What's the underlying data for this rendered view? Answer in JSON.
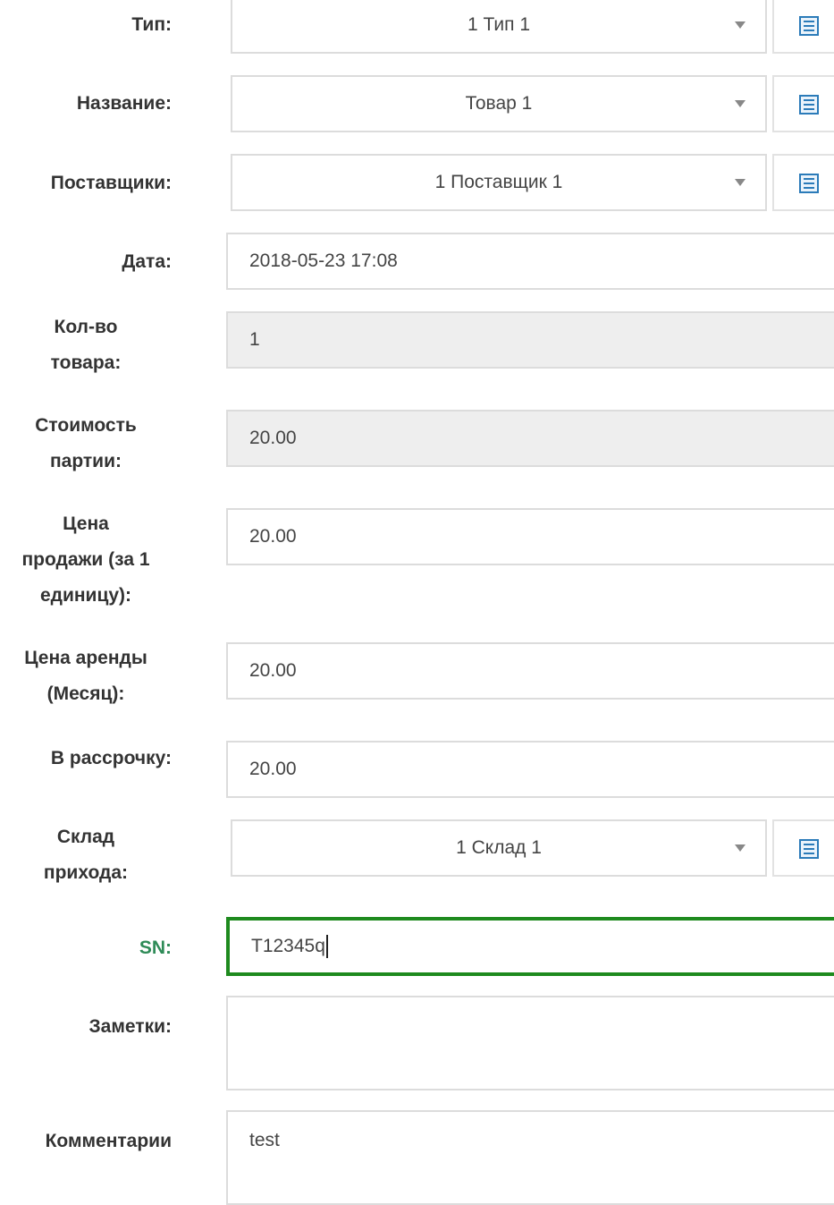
{
  "form": {
    "type": {
      "label": "Тип:",
      "value": "1 Тип 1"
    },
    "name": {
      "label": "Название:",
      "value": "Товар 1"
    },
    "suppliers": {
      "label": "Поставщики:",
      "value": "1 Поставщик 1"
    },
    "date": {
      "label": "Дата:",
      "value": "2018-05-23 17:08"
    },
    "quantity": {
      "label_line1": "Кол-во",
      "label_line2": "товара:",
      "value": "1"
    },
    "batch_cost": {
      "label_line1": "Стоимость",
      "label_line2": "партии:",
      "value": "20.00"
    },
    "sale_price": {
      "label_line1": "Цена",
      "label_line2": "продажи (за 1",
      "label_line3": "единицу):",
      "value": "20.00"
    },
    "rent_price": {
      "label_line1": "Цена аренды",
      "label_line2": "(Месяц):",
      "value": "20.00"
    },
    "installment": {
      "label": "В рассрочку:",
      "value": "20.00"
    },
    "warehouse": {
      "label_line1": "Склад",
      "label_line2": "прихода:",
      "value": "1 Склад 1"
    },
    "sn": {
      "label": "SN:",
      "value": "T12345q"
    },
    "notes": {
      "label": "Заметки:",
      "value": ""
    },
    "comments": {
      "label": "Комментарии",
      "value": "test"
    }
  },
  "colors": {
    "active_border": "#1e8a1e",
    "sn_label": "#2e8b57",
    "list_icon": "#2b7bb9"
  }
}
